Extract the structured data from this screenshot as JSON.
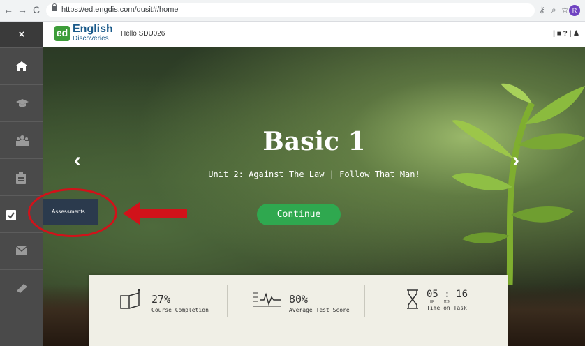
{
  "browser": {
    "url": "https://ed.engdis.com/dusit#/home",
    "back": "←",
    "forward": "→",
    "reload": "C",
    "profile_initial": "R"
  },
  "sidebar": {
    "close": "×",
    "items": [
      {
        "name": "home-icon"
      },
      {
        "name": "graduation-cap-icon"
      },
      {
        "name": "community-icon"
      },
      {
        "name": "clipboard-icon"
      },
      {
        "name": "assessment-check-icon"
      },
      {
        "name": "mail-icon"
      },
      {
        "name": "book-icon"
      }
    ],
    "tooltip": "Assessments"
  },
  "header": {
    "logo_mark": "ed",
    "logo_line1": "English",
    "logo_line2": "Discoveries",
    "greeting": "Hello SDU026",
    "right_icons": "| ■  ? | ♟"
  },
  "hero": {
    "title": "Basic 1",
    "subtitle": "Unit 2: Against The Law | Follow That Man!",
    "continue_label": "Continue",
    "prev_arrow": "‹",
    "next_arrow": "›"
  },
  "stats": {
    "completion": {
      "value": "27%",
      "label": "Course Completion"
    },
    "test_score": {
      "value": "80%",
      "label": "Average Test Score"
    },
    "time": {
      "value": "05 : 16",
      "unit_hr": "HR",
      "unit_min": "MIN",
      "label": "Time on Task"
    }
  },
  "colors": {
    "accent_green": "#2fa84f",
    "annotation_red": "#d1121a",
    "sidebar_bg": "#4a4a4a"
  }
}
